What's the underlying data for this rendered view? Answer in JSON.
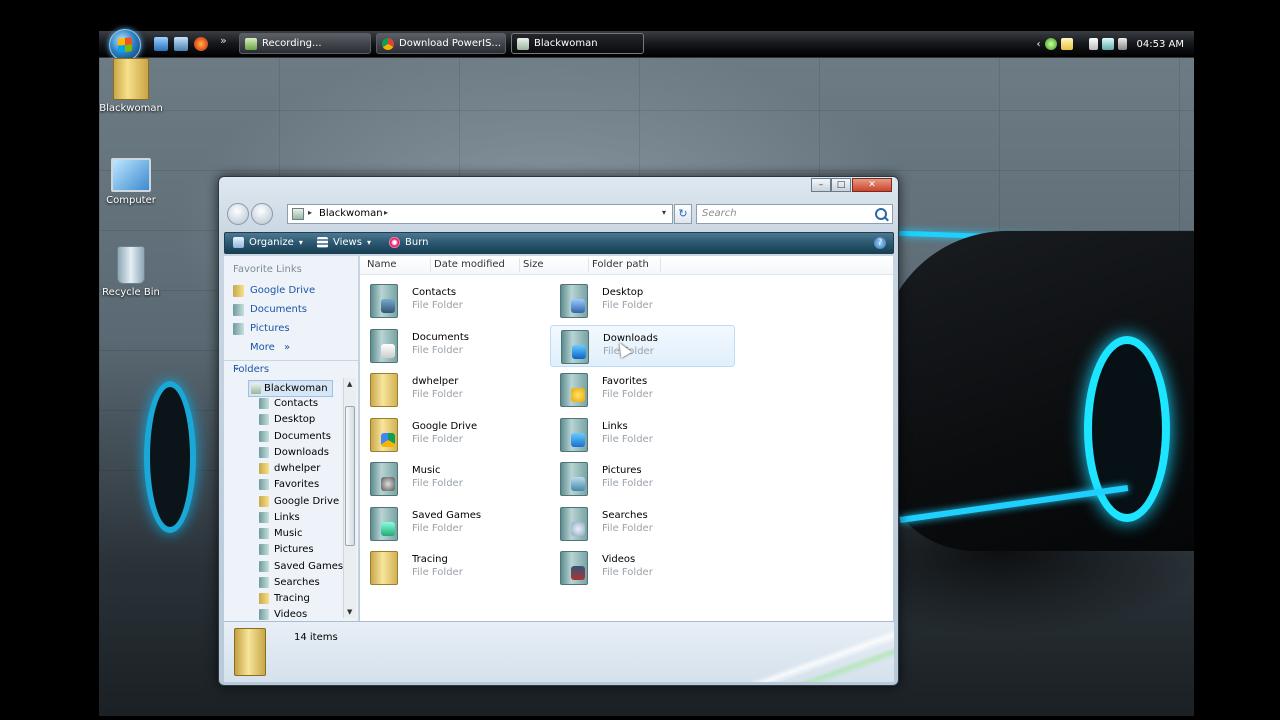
{
  "taskbar": {
    "quick_launch_more": "»",
    "buttons": [
      {
        "label": "Recording..."
      },
      {
        "label": "Download PowerIS..."
      },
      {
        "label": "Blackwoman"
      }
    ],
    "tray": {
      "expand": "‹",
      "clock": "04:53 AM"
    }
  },
  "desktop": {
    "icons": [
      {
        "label": "Blackwoman"
      },
      {
        "label": "Computer"
      },
      {
        "label": "Recycle Bin"
      }
    ]
  },
  "window": {
    "address": {
      "sep": "▸",
      "crumb": "Blackwoman",
      "sep2": "▸",
      "dropdown": "▾"
    },
    "refresh": "↻",
    "search_placeholder": "Search",
    "toolbar": {
      "organize": "Organize",
      "views": "Views",
      "burn": "Burn",
      "caret": "▾",
      "help": "?"
    },
    "nav": {
      "favorite_links_header": "Favorite Links",
      "favorite_links": [
        {
          "label": "Google Drive"
        },
        {
          "label": "Documents"
        },
        {
          "label": "Pictures"
        }
      ],
      "more": "More",
      "more_chevron": "»",
      "folders_header": "Folders",
      "folders_chevron": "⌄",
      "tree_root": "Blackwoman",
      "tree": [
        "Contacts",
        "Desktop",
        "Documents",
        "Downloads",
        "dwhelper",
        "Favorites",
        "Google Drive",
        "Links",
        "Music",
        "Pictures",
        "Saved Games",
        "Searches",
        "Tracing",
        "Videos"
      ],
      "scroll_up": "▲",
      "scroll_down": "▼"
    },
    "columns": [
      "Name",
      "Date modified",
      "Size",
      "Folder path"
    ],
    "items_left": [
      {
        "name": "Contacts",
        "type": "File Folder"
      },
      {
        "name": "Documents",
        "type": "File Folder"
      },
      {
        "name": "dwhelper",
        "type": "File Folder"
      },
      {
        "name": "Google Drive",
        "type": "File Folder"
      },
      {
        "name": "Music",
        "type": "File Folder"
      },
      {
        "name": "Saved Games",
        "type": "File Folder"
      },
      {
        "name": "Tracing",
        "type": "File Folder"
      }
    ],
    "items_right": [
      {
        "name": "Desktop",
        "type": "File Folder"
      },
      {
        "name": "Downloads",
        "type": "File Folder"
      },
      {
        "name": "Favorites",
        "type": "File Folder"
      },
      {
        "name": "Links",
        "type": "File Folder"
      },
      {
        "name": "Pictures",
        "type": "File Folder"
      },
      {
        "name": "Searches",
        "type": "File Folder"
      },
      {
        "name": "Videos",
        "type": "File Folder"
      }
    ],
    "details": {
      "count": "14 items"
    },
    "controls": {
      "minimize": "–",
      "maximize": "□",
      "close": "✕"
    }
  }
}
